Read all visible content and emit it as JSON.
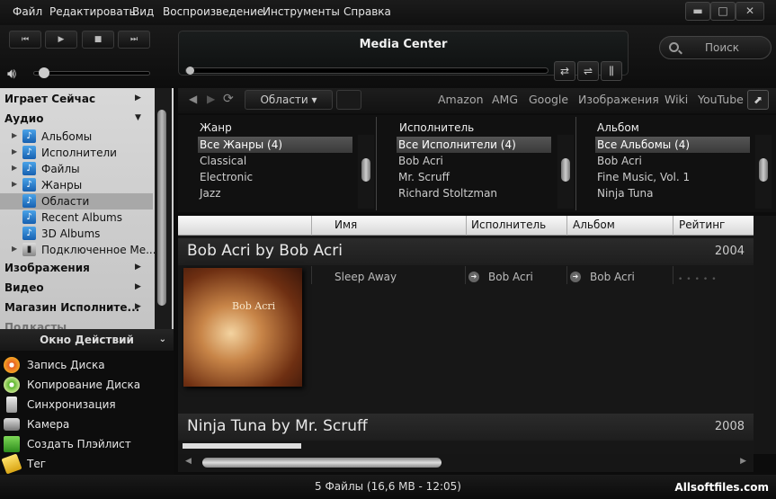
{
  "menu": [
    "Файл",
    "Редактировать",
    "Вид",
    "Воспроизведение",
    "Инструменты",
    "Справка"
  ],
  "window_buttons": {
    "minimize": "▬",
    "maximize": "□",
    "close": "✕"
  },
  "player": {
    "title": "Media Center",
    "search_label": "Поиск",
    "transport": [
      "⏮",
      "▶",
      "■",
      "⏭"
    ]
  },
  "tree": {
    "items": [
      {
        "label": "Играет Сейчас",
        "bold": true
      },
      {
        "label": "Аудио",
        "bold": true
      },
      {
        "label": "Альбомы"
      },
      {
        "label": "Исполнители"
      },
      {
        "label": "Файлы"
      },
      {
        "label": "Жанры"
      },
      {
        "label": "Области",
        "selected": true
      },
      {
        "label": "Recent Albums"
      },
      {
        "label": "3D Albums"
      },
      {
        "label": "Подключенное Ме..."
      },
      {
        "label": "Изображения",
        "bold": true
      },
      {
        "label": "Видео",
        "bold": true
      },
      {
        "label": "Магазин Исполните...",
        "bold": true
      },
      {
        "label": "Подкасты",
        "bold": true
      }
    ]
  },
  "actions": {
    "title": "Окно Действий",
    "items": [
      "Запись Диска",
      "Копирование Диска",
      "Синхронизация",
      "Камера",
      "Создать Плэйлист",
      "Тег"
    ]
  },
  "nav": {
    "view": "Области ▾",
    "links": [
      "Amazon",
      "AMG",
      "Google",
      "Изображения",
      "Wiki",
      "YouTube"
    ]
  },
  "pane": {
    "genre": {
      "header": "Жанр",
      "items": [
        "Все Жанры (4)",
        "Classical",
        "Electronic",
        "Jazz"
      ]
    },
    "artist": {
      "header": "Исполнитель",
      "items": [
        "Все Исполнители (4)",
        "Bob Acri",
        "Mr. Scruff",
        "Richard Stoltzman"
      ]
    },
    "album": {
      "header": "Альбом",
      "items": [
        "Все Альбомы (4)",
        "Bob Acri",
        "Fine Music, Vol. 1",
        "Ninja Tuna"
      ]
    }
  },
  "columns": [
    "Имя",
    "Исполнитель",
    "Альбом",
    "Рейтинг"
  ],
  "groups": [
    {
      "title": "Bob Acri by Bob Acri",
      "year": "2004",
      "track": "Sleep Away",
      "artist": "Bob Acri",
      "album": "Bob Acri",
      "cover_text": "Bob Acri"
    },
    {
      "title": "Ninja Tuna by Mr. Scruff",
      "year": "2008"
    }
  ],
  "status": "5 Файлы (16,6 MB - 12:05)",
  "watermark": "Allsoftfiles.com"
}
